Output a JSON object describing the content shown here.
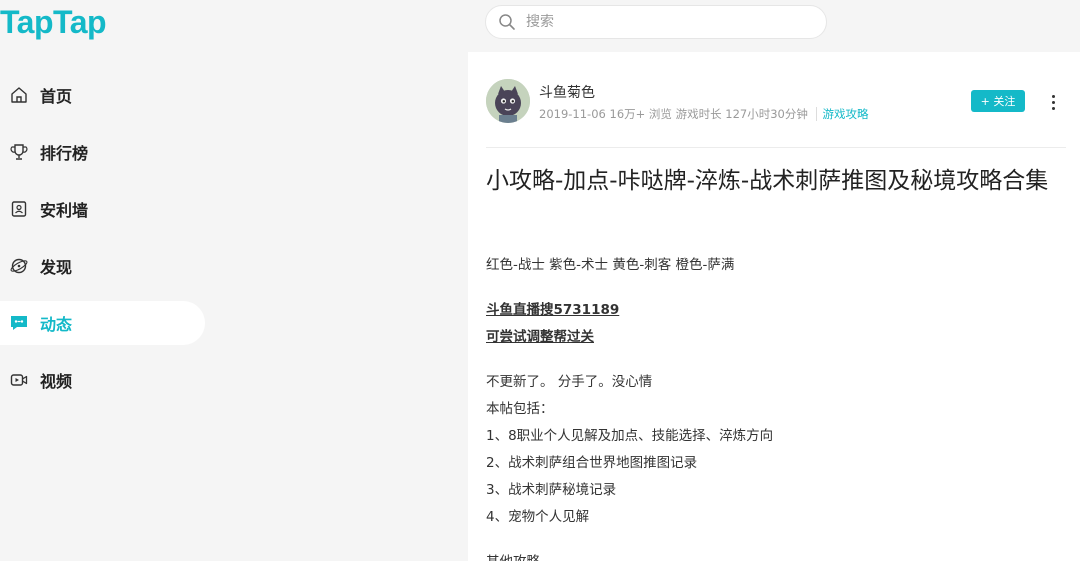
{
  "brand": {
    "logo": "TapTap",
    "accent": "#14b9c8"
  },
  "search": {
    "placeholder": "搜索"
  },
  "nav": {
    "items": [
      {
        "label": "首页",
        "icon": "home-icon"
      },
      {
        "label": "排行榜",
        "icon": "trophy-icon"
      },
      {
        "label": "安利墙",
        "icon": "recommend-wall-icon"
      },
      {
        "label": "发现",
        "icon": "discover-icon"
      },
      {
        "label": "动态",
        "icon": "chat-bubble-icon",
        "active": true
      },
      {
        "label": "视频",
        "icon": "video-icon"
      }
    ]
  },
  "post": {
    "author": "斗鱼菊色",
    "date": "2019-11-06",
    "views": "16万+ 浏览",
    "playtime": "游戏时长 127小时30分钟",
    "tag": "游戏攻略",
    "follow_label": "+ 关注",
    "title": "小攻略-加点-咔哒牌-淬炼-战术刺萨推图及秘境攻略合集",
    "body": {
      "line1": "红色-战士  紫色-术士 黄色-刺客 橙色-萨满",
      "bold1": "斗鱼直播搜5731189",
      "bold2": "可尝试调整帮过关",
      "line2": "不更新了。 分手了。没心情",
      "line3": "本帖包括：",
      "list": [
        "1、8职业个人见解及加点、技能选择、淬炼方向",
        "2、战术刺萨组合世界地图推图记录",
        "3、战术刺萨秘境记录",
        "4、宠物个人见解"
      ],
      "line4": "其他攻略"
    }
  }
}
